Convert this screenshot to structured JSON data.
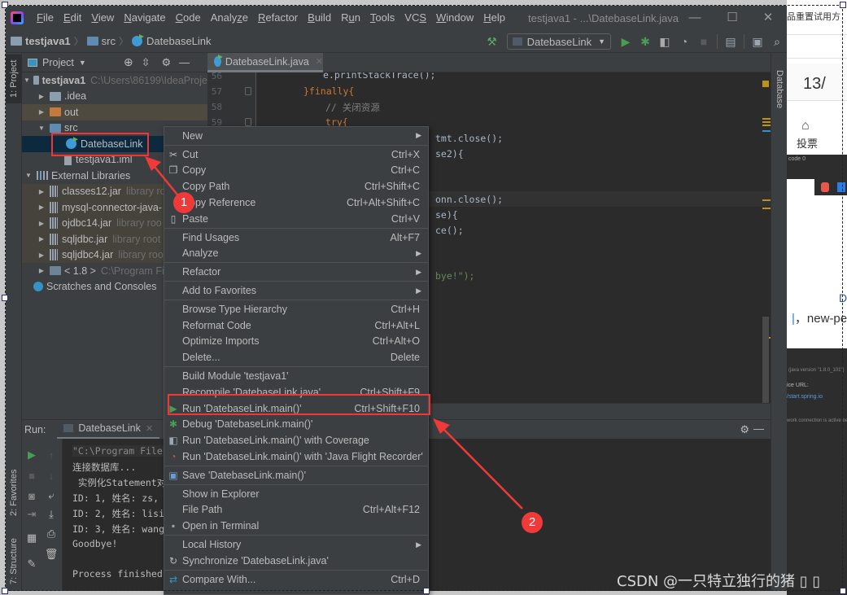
{
  "menubar": {
    "items": [
      {
        "label": "File",
        "mnemonic": "F"
      },
      {
        "label": "Edit",
        "mnemonic": "E"
      },
      {
        "label": "View",
        "mnemonic": "V"
      },
      {
        "label": "Navigate",
        "mnemonic": "N"
      },
      {
        "label": "Code",
        "mnemonic": "C"
      },
      {
        "label": "Analyze",
        "mnemonic": "z"
      },
      {
        "label": "Refactor",
        "mnemonic": "R"
      },
      {
        "label": "Build",
        "mnemonic": "B"
      },
      {
        "label": "Run",
        "mnemonic": "u"
      },
      {
        "label": "Tools",
        "mnemonic": "T"
      },
      {
        "label": "VCS",
        "mnemonic": "S"
      },
      {
        "label": "Window",
        "mnemonic": "W"
      },
      {
        "label": "Help",
        "mnemonic": "H"
      }
    ],
    "window_title": "testjava1 - ...\\DatebaseLink.java",
    "controls": {
      "minimize": "—",
      "maximize": "☐",
      "close": "✕"
    }
  },
  "navbar": {
    "breadcrumbs": [
      "testjava1",
      "src",
      "DatebaseLink"
    ],
    "run_config": "DatebaseLink",
    "toolbar_icons": [
      "build-hammer-icon",
      "run-icon",
      "debug-icon",
      "coverage-icon",
      "profile-icon",
      "stop-icon",
      "project-structure-icon",
      "terminal-icon",
      "search-icon"
    ]
  },
  "left_stripe": {
    "project": "1: Project",
    "favorites": "2: Favorites",
    "structure": "7: Structure"
  },
  "right_stripe": {
    "database": "Database"
  },
  "project_panel": {
    "title": "Project",
    "tree": [
      {
        "label": "testjava1",
        "hint": "C:\\Users\\86199\\IdeaProje",
        "type": "module",
        "expanded": true,
        "bold": true
      },
      {
        "label": ".idea",
        "type": "folder",
        "expanded": false
      },
      {
        "label": "out",
        "type": "folder-excluded",
        "expanded": false
      },
      {
        "label": "src",
        "type": "folder-src",
        "expanded": true
      },
      {
        "label": "DatebaseLink",
        "type": "class",
        "selected": true
      },
      {
        "label": "testjava1.iml",
        "type": "iml"
      },
      {
        "label": "External Libraries",
        "type": "libraries",
        "expanded": true
      },
      {
        "label": "classes12.jar",
        "hint": "library ro",
        "type": "jar"
      },
      {
        "label": "mysql-connector-java-",
        "hint": "",
        "type": "jar"
      },
      {
        "label": "ojdbc14.jar",
        "hint": "library roo",
        "type": "jar"
      },
      {
        "label": "sqljdbc.jar",
        "hint": "library root",
        "type": "jar"
      },
      {
        "label": "sqljdbc4.jar",
        "hint": "library roo",
        "type": "jar"
      },
      {
        "label": "< 1.8 >",
        "hint": "C:\\Program Fil",
        "type": "jdk"
      },
      {
        "label": "Scratches and Consoles",
        "type": "scratches"
      }
    ]
  },
  "editor": {
    "tab": "DatebaseLink.java",
    "lines": [
      {
        "n": "56",
        "text": "e.printStackTrace();"
      },
      {
        "n": "57",
        "text": "}finally{"
      },
      {
        "n": "58",
        "text": "// 关闭资源"
      },
      {
        "n": "59",
        "text": "try{"
      }
    ],
    "visible_fragments": [
      "tmt.close();",
      "se2){",
      "onn.close();",
      "se){",
      "ce();",
      "bye!\");"
    ]
  },
  "run_panel": {
    "label": "Run:",
    "tab": "DatebaseLink",
    "console": [
      "\"C:\\Program Files",
      "连接数据库...",
      " 实例化Statement对",
      "ID: 1, 姓名: zs,",
      "ID: 2, 姓名: lisi",
      "ID: 3, 姓名: wang",
      "Goodbye!",
      "",
      "Process finished"
    ]
  },
  "context_menu": {
    "items": [
      {
        "label": "New",
        "shortcut": "",
        "submenu": true,
        "icon": ""
      },
      {
        "sep": true
      },
      {
        "label": "Cut",
        "shortcut": "Ctrl+X",
        "icon": "scissors-icon"
      },
      {
        "label": "Copy",
        "shortcut": "Ctrl+C",
        "icon": "copy-icon"
      },
      {
        "label": "Copy Path",
        "shortcut": "Ctrl+Shift+C",
        "icon": ""
      },
      {
        "label": "Copy Reference",
        "shortcut": "Ctrl+Alt+Shift+C",
        "icon": ""
      },
      {
        "label": "Paste",
        "shortcut": "Ctrl+V",
        "icon": "paste-icon"
      },
      {
        "sep": true
      },
      {
        "label": "Find Usages",
        "shortcut": "Alt+F7",
        "icon": ""
      },
      {
        "label": "Analyze",
        "shortcut": "",
        "submenu": true,
        "icon": ""
      },
      {
        "sep": true
      },
      {
        "label": "Refactor",
        "shortcut": "",
        "submenu": true,
        "icon": ""
      },
      {
        "sep": true
      },
      {
        "label": "Add to Favorites",
        "shortcut": "",
        "submenu": true,
        "icon": ""
      },
      {
        "sep": true
      },
      {
        "label": "Browse Type Hierarchy",
        "shortcut": "Ctrl+H",
        "icon": ""
      },
      {
        "label": "Reformat Code",
        "shortcut": "Ctrl+Alt+L",
        "icon": ""
      },
      {
        "label": "Optimize Imports",
        "shortcut": "Ctrl+Alt+O",
        "icon": ""
      },
      {
        "label": "Delete...",
        "shortcut": "Delete",
        "icon": ""
      },
      {
        "sep": true
      },
      {
        "label": "Build Module 'testjava1'",
        "shortcut": "",
        "icon": ""
      },
      {
        "label": "Recompile 'DatebaseLink.java'",
        "shortcut": "Ctrl+Shift+F9",
        "icon": ""
      },
      {
        "label": "Run 'DatebaseLink.main()'",
        "shortcut": "Ctrl+Shift+F10",
        "icon": "run-icon",
        "highlighted": true
      },
      {
        "label": "Debug 'DatebaseLink.main()'",
        "shortcut": "",
        "icon": "debug-icon"
      },
      {
        "label": "Run 'DatebaseLink.main()' with Coverage",
        "shortcut": "",
        "icon": "coverage-icon"
      },
      {
        "label": "Run 'DatebaseLink.main()' with 'Java Flight Recorder'",
        "shortcut": "",
        "icon": "profile-icon"
      },
      {
        "sep": true
      },
      {
        "label": "Save 'DatebaseLink.main()'",
        "shortcut": "",
        "icon": "save-config-icon"
      },
      {
        "sep": true
      },
      {
        "label": "Show in Explorer",
        "shortcut": "",
        "icon": ""
      },
      {
        "label": "File Path",
        "shortcut": "Ctrl+Alt+F12",
        "icon": ""
      },
      {
        "label": "Open in Terminal",
        "shortcut": "",
        "icon": "terminal-icon"
      },
      {
        "sep": true
      },
      {
        "label": "Local History",
        "shortcut": "",
        "submenu": true,
        "icon": ""
      },
      {
        "label": "Synchronize 'DatebaseLink.java'",
        "shortcut": "",
        "icon": "sync-icon"
      },
      {
        "sep": true
      },
      {
        "label": "Compare With...",
        "shortcut": "Ctrl+D",
        "icon": "compare-icon"
      }
    ]
  },
  "annotations": {
    "badge1": "1",
    "badge2": "2",
    "color": "#f03a3a"
  },
  "background_browser": {
    "top_text": "品重置试用方",
    "page_number": "13/",
    "vote_label": "投票",
    "code_fragment": "code 0",
    "text_fragment": "new-pe",
    "d_fragment": "D",
    "java_version": "(java version \"1.8.0_101\")",
    "service_url": "ice URL:",
    "spring_url": "/start.spring.io",
    "network": "work connection is active befo"
  },
  "watermark": "CSDN @一只特立独行的猪 ▯ ▯"
}
